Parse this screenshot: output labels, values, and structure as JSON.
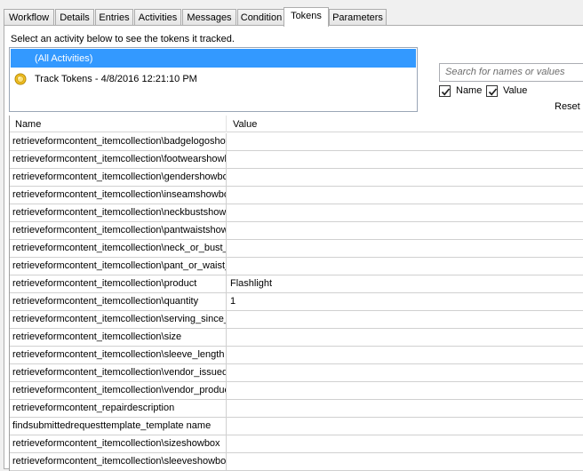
{
  "tabs": [
    "Workflow",
    "Details",
    "Entries",
    "Activities",
    "Messages",
    "Condition",
    "Tokens",
    "Parameters"
  ],
  "active_tab": "Tokens",
  "activity_prompt": "Select an activity below to see the tokens it tracked.",
  "activities": [
    {
      "label": "(All Activities)",
      "selected": true
    },
    {
      "label": "Track Tokens - 4/8/2016 12:21:10 PM",
      "icon": "token-icon"
    }
  ],
  "search": {
    "placeholder": "Search for names or values"
  },
  "filters": {
    "name_label": "Name",
    "name_checked": true,
    "value_label": "Value",
    "value_checked": true
  },
  "reset_label": "Reset s",
  "grid": {
    "columns": [
      "Name",
      "Value"
    ],
    "rows": [
      {
        "name": "retrieveformcontent_itemcollection\\badgelogoshow",
        "value": ""
      },
      {
        "name": "retrieveformcontent_itemcollection\\footwearshowbo",
        "value": ""
      },
      {
        "name": "retrieveformcontent_itemcollection\\gendershowbox",
        "value": ""
      },
      {
        "name": "retrieveformcontent_itemcollection\\inseamshowbox",
        "value": ""
      },
      {
        "name": "retrieveformcontent_itemcollection\\neckbustshow_",
        "value": ""
      },
      {
        "name": "retrieveformcontent_itemcollection\\pantwaistshowb",
        "value": ""
      },
      {
        "name": "retrieveformcontent_itemcollection\\neck_or_bust_s",
        "value": ""
      },
      {
        "name": "retrieveformcontent_itemcollection\\pant_or_waist_s",
        "value": ""
      },
      {
        "name": "retrieveformcontent_itemcollection\\product",
        "value": "Flashlight"
      },
      {
        "name": "retrieveformcontent_itemcollection\\quantity",
        "value": "1"
      },
      {
        "name": "retrieveformcontent_itemcollection\\serving_since_y",
        "value": ""
      },
      {
        "name": "retrieveformcontent_itemcollection\\size",
        "value": ""
      },
      {
        "name": "retrieveformcontent_itemcollection\\sleeve_length",
        "value": ""
      },
      {
        "name": "retrieveformcontent_itemcollection\\vendor_issued",
        "value": ""
      },
      {
        "name": "retrieveformcontent_itemcollection\\vendor_product",
        "value": ""
      },
      {
        "name": "retrieveformcontent_repairdescription",
        "value": ""
      },
      {
        "name": "findsubmittedrequesttemplate_template name",
        "value": ""
      },
      {
        "name": "retrieveformcontent_itemcollection\\sizeshowbox",
        "value": ""
      },
      {
        "name": "retrieveformcontent_itemcollection\\sleeveshowbox",
        "value": ""
      }
    ]
  },
  "colors": {
    "selection": "#3399ff",
    "panel": "#ffffff",
    "chrome": "#f0f0f0"
  }
}
